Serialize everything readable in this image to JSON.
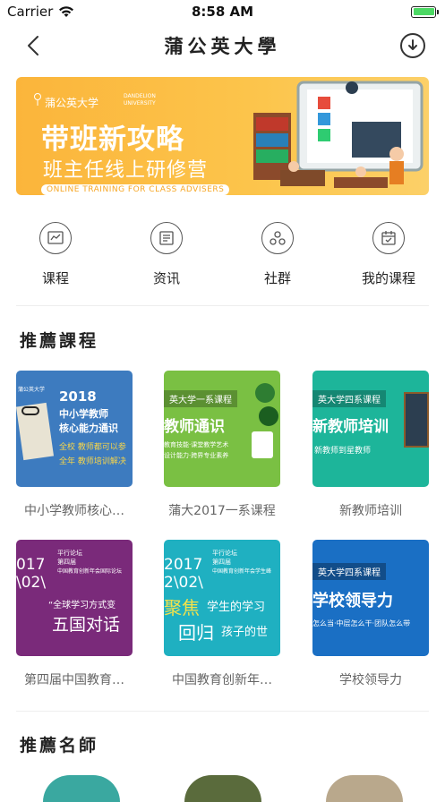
{
  "status_bar": {
    "carrier": "Carrier",
    "time": "8:58 AM",
    "battery_level": 1.0
  },
  "nav": {
    "title": "蒲公英大學",
    "back_icon": "chevron-left-icon",
    "download_icon": "download-circle-icon"
  },
  "banner": {
    "brand": "蒲公英大学",
    "brand_en": "DANDELION UNIVERSITY",
    "title": "带班新攻略",
    "subtitle": "班主任线上研修营",
    "english": "ONLINE TRAINING FOR CLASS ADVISERS"
  },
  "quick_nav": [
    {
      "label": "课程",
      "icon": "chart-icon"
    },
    {
      "label": "资讯",
      "icon": "news-icon"
    },
    {
      "label": "社群",
      "icon": "community-icon"
    },
    {
      "label": "我的课程",
      "icon": "calendar-check-icon"
    }
  ],
  "sections": {
    "recommended_courses": "推薦課程",
    "recommended_teachers": "推薦名師"
  },
  "courses": [
    {
      "name": "中小学教师核心…",
      "thumb": {
        "year": "2018",
        "line1": "中小学教师",
        "line2": "核心能力通识",
        "line3": "全校 教师都可以参",
        "line4": "全年 教师培训解决",
        "brand": "蒲公英大学"
      }
    },
    {
      "name": "蒲大2017一系课程",
      "thumb": {
        "tag": "英大学一系课程",
        "title": "教师通识",
        "line1": "教育技能·课堂教学艺术",
        "line2": "设计能力·跨界专业素养"
      }
    },
    {
      "name": "新教师培训",
      "thumb": {
        "tag": "英大学四系课程",
        "title": "新教师培训",
        "line1": "新教师到星教师"
      }
    },
    {
      "name": "第四届中国教育…",
      "thumb": {
        "year": "017",
        "year2": "\\02\\",
        "forum": "平行论坛",
        "session": "第四届",
        "org": "中国教育创新年会国际论坛",
        "quote": "“全球学习方式变",
        "title": "五国对话"
      }
    },
    {
      "name": "中国教育创新年…",
      "thumb": {
        "year": "2017",
        "year2": "2\\02\\",
        "forum": "平行论坛",
        "session": "第四届",
        "org": "中国教育创新年会学生峰",
        "big1": "聚焦",
        "small1": "学生的学习",
        "big2": "回归",
        "small2": "孩子的世"
      }
    },
    {
      "name": "学校领导力",
      "thumb": {
        "tag": "英大学四系课程",
        "title": "学校领导力",
        "line1": "怎么当·中层怎么干·团队怎么带"
      }
    }
  ],
  "colors": {
    "banner": "#fbb53b",
    "course1": "#3d7bbf",
    "course2": "#7ac043",
    "course3": "#1db59a",
    "course4": "#7a2a7a",
    "course5": "#1fb0c1",
    "course6": "#1a6fc4"
  }
}
